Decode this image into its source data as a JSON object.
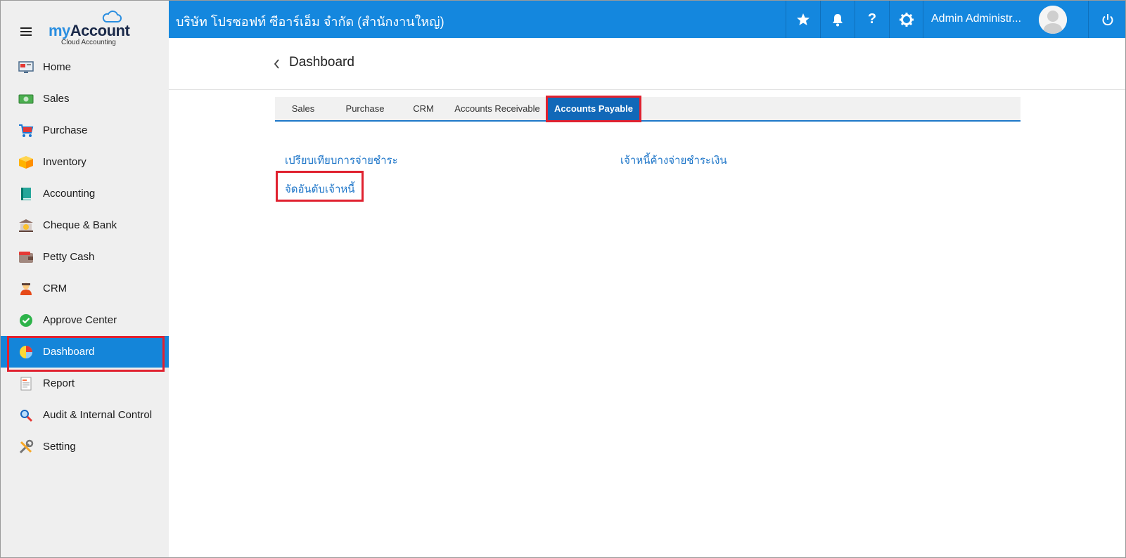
{
  "app": {
    "logo_my": "my",
    "logo_account": "Account",
    "logo_sub": "Cloud Accounting"
  },
  "sidebar": {
    "items": [
      {
        "label": "Home",
        "icon": "monitor-icon"
      },
      {
        "label": "Sales",
        "icon": "cash-icon"
      },
      {
        "label": "Purchase",
        "icon": "cart-icon"
      },
      {
        "label": "Inventory",
        "icon": "box-icon"
      },
      {
        "label": "Accounting",
        "icon": "book-icon"
      },
      {
        "label": "Cheque & Bank",
        "icon": "bank-icon"
      },
      {
        "label": "Petty Cash",
        "icon": "wallet-icon"
      },
      {
        "label": "CRM",
        "icon": "people-icon"
      },
      {
        "label": "Approve Center",
        "icon": "check-circle-icon"
      },
      {
        "label": "Dashboard",
        "icon": "pie-chart-icon",
        "active": true
      },
      {
        "label": "Report",
        "icon": "report-icon"
      },
      {
        "label": "Audit & Internal Control",
        "icon": "magnifier-icon"
      },
      {
        "label": "Setting",
        "icon": "tools-icon"
      }
    ]
  },
  "topbar": {
    "company": "บริษัท โปรซอฟท์ ซีอาร์เอ็ม จำกัด (สำนักงานใหญ่)",
    "user_name": "Admin Administr...",
    "icons": [
      "star-icon",
      "bell-icon",
      "help-icon",
      "gear-icon",
      "power-icon"
    ],
    "help_glyph": "?"
  },
  "page": {
    "title": "Dashboard",
    "tabs": [
      {
        "label": "Sales"
      },
      {
        "label": "Purchase"
      },
      {
        "label": "CRM"
      },
      {
        "label": "Accounts Receivable"
      },
      {
        "label": "Accounts Payable",
        "active": true
      }
    ],
    "links": [
      "เปรียบเทียบการจ่ายชำระ",
      "เจ้าหนี้ค้างจ่ายชำระเงิน",
      "จัดอันดับเจ้าหนี้"
    ]
  },
  "colors": {
    "topbar": "#1487de",
    "active_nav": "#1485d9",
    "active_tab": "#1168b8",
    "highlight": "#e0212f",
    "link": "#1b74c8"
  }
}
